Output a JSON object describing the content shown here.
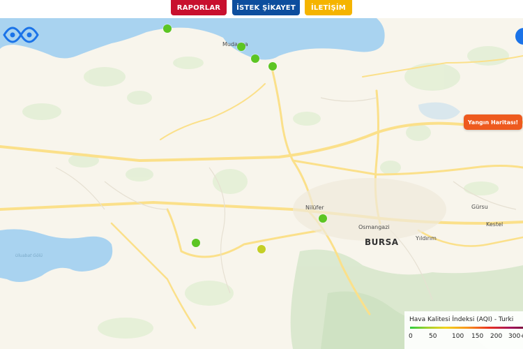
{
  "nav": {
    "reports": "RAPORLAR",
    "requests": "İSTEK ŞİKAYET",
    "contact": "İLETİŞİM"
  },
  "colors": {
    "reports_bg": "#c8102e",
    "requests_bg": "#0d4e9e",
    "contact_bg": "#f5b400",
    "water": "#a9d3f0",
    "road": "#fbe08a",
    "fire_button": "#ee5a1e",
    "aqi_good": "#5cc523",
    "aqi_moderate": "#c4cf26"
  },
  "map": {
    "labels": {
      "mudanya": "Mudanya",
      "nilufer": "Nilüfer",
      "osmangazi": "Osmangazi",
      "bursa": "BURSA",
      "yildirim": "Yıldırım",
      "gursu": "Gürsu",
      "kestel": "Kestel",
      "uluabat": "Uluabat Gölü"
    },
    "fire_map_button": "Yangın Haritası!",
    "sensors": [
      {
        "aqi_level": "good"
      },
      {
        "aqi_level": "good"
      },
      {
        "aqi_level": "good"
      },
      {
        "aqi_level": "good"
      },
      {
        "aqi_level": "good"
      },
      {
        "aqi_level": "good"
      },
      {
        "aqi_level": "moderate"
      }
    ]
  },
  "legend": {
    "title": "Hava Kalitesi İndeksi (AQI) - Turki",
    "ticks": [
      "0",
      "50",
      "100",
      "150",
      "200",
      "300+"
    ]
  },
  "icons": {
    "logo": "eye-logo-icon",
    "side": "circle-button-icon"
  }
}
